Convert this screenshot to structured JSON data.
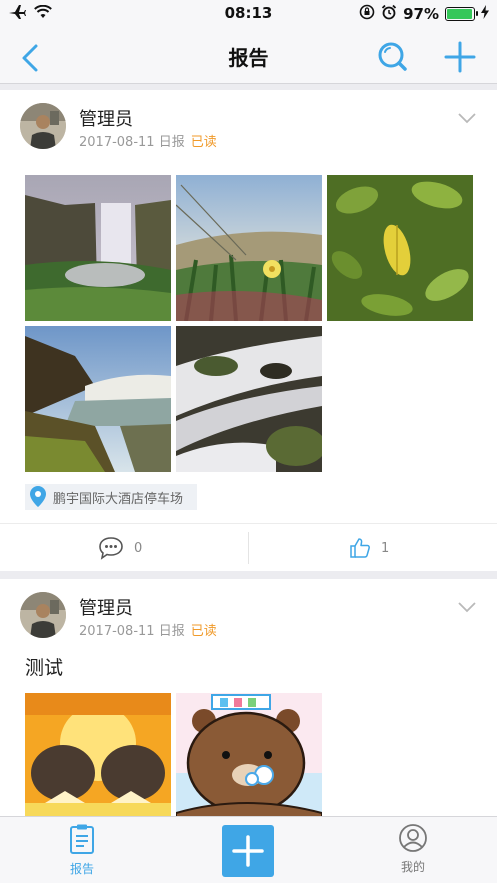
{
  "status_bar": {
    "time": "08:13",
    "battery_percent": "97%",
    "battery_level": 0.97
  },
  "nav": {
    "title": "报告"
  },
  "posts": [
    {
      "author": "管理员",
      "date": "2017-08-11",
      "type": "日报",
      "read_status": "已读",
      "location": "鹏宇国际大酒店停车场",
      "comment_count": "0",
      "like_count": "1"
    },
    {
      "author": "管理员",
      "date": "2017-08-11",
      "type": "日报",
      "read_status": "已读",
      "text": "测试"
    }
  ],
  "tabs": [
    {
      "label": "报告"
    },
    {
      "label": "我的"
    }
  ],
  "colors": {
    "accent": "#3fa6e6",
    "read": "#f09a2a"
  }
}
